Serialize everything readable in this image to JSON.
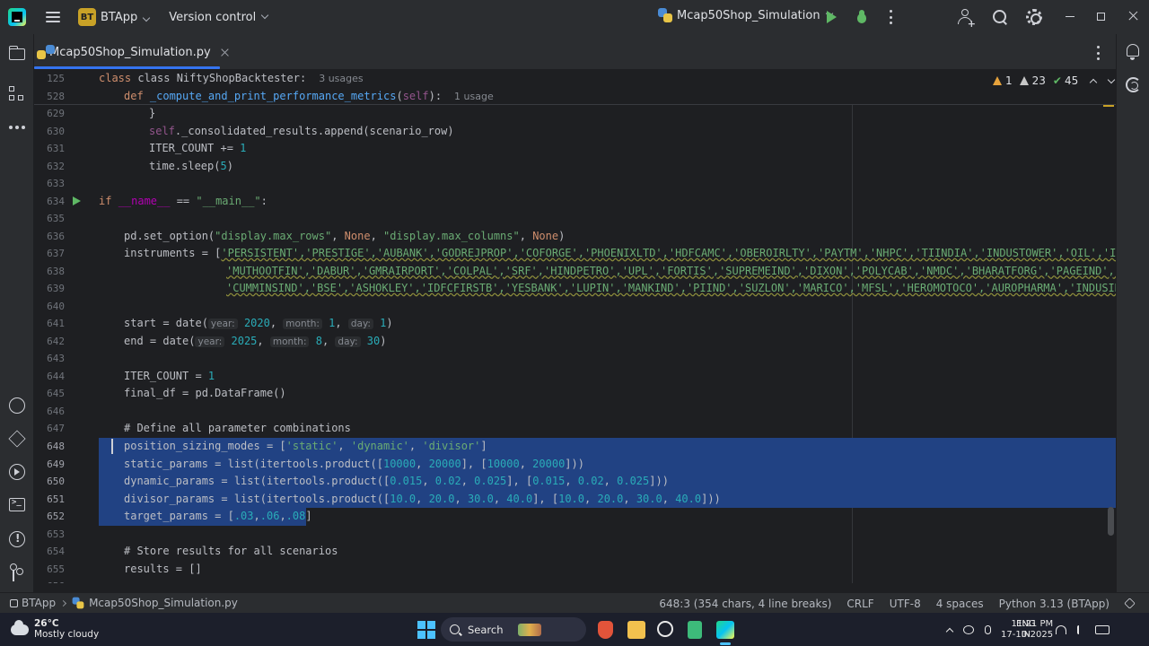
{
  "titlebar": {
    "project_badge": "BT",
    "project_name": "BTApp",
    "vcs_label": "Version control",
    "run_config": "Mcap50Shop_Simulation",
    "icons": [
      "app-logo-icon",
      "hamburger-menu-icon",
      "chevron-down-icon",
      "run-icon",
      "debug-icon",
      "more-icon",
      "add-user-icon",
      "search-icon",
      "gear-icon",
      "minimize-icon",
      "maximize-icon",
      "close-icon"
    ]
  },
  "tab": {
    "label": "Mcap50Shop_Simulation.py"
  },
  "inspections": {
    "warnings": "1",
    "weak_warnings": "23",
    "ok": "45"
  },
  "sticky": [
    {
      "ln": "125",
      "code": "class NiftyShopBacktester:",
      "usage": "3 usages"
    },
    {
      "ln": "528",
      "code": "def _compute_and_print_performance_metrics(self):",
      "usage": "1 usage"
    }
  ],
  "code": {
    "l629": {
      "ln": "629",
      "t": "}"
    },
    "l630": {
      "ln": "630",
      "a": "self",
      "b": "._consolidated_results.append(scenario_row)"
    },
    "l631": {
      "ln": "631",
      "a": "ITER_COUNT += ",
      "b": "1"
    },
    "l632": {
      "ln": "632",
      "a": "time.sleep(",
      "b": "5",
      "c": ")"
    },
    "l633": {
      "ln": "633"
    },
    "l634": {
      "ln": "634",
      "kw": "if ",
      "a": "__name__",
      "b": " == ",
      "s": "\"__main__\"",
      "c": ":"
    },
    "l635": {
      "ln": "635"
    },
    "l636": {
      "ln": "636",
      "a": "pd.set_option(",
      "s1": "\"display.max_rows\"",
      "b": ", ",
      "k1": "None",
      "c": ", ",
      "s2": "\"display.max_columns\"",
      "d": ", ",
      "k2": "None",
      "e": ")"
    },
    "l637": {
      "ln": "637",
      "a": "instruments = [",
      "s": "'PERSISTENT','PRESTIGE','AUBANK','GODREJPROP','COFORGE','PHOENIXLTD','HDFCAMC','OBEROIRLTY','PAYTM','NHPC','TIINDIA','INDUSTOWER','OIL','IRCTC'"
    },
    "l638": {
      "ln": "638",
      "s": "'MUTHOOTFIN','DABUR','GMRAIRPORT','COLPAL','SRF','HINDPETRO','UPL','FORTIS','SUPREMEIND','DIXON','POLYCAB','NMDC','BHARATFORG','PAGEIND','JUBL"
    },
    "l639": {
      "ln": "639",
      "s": "'CUMMINSIND','BSE','ASHOKLEY','IDFCFIRSTB','YESBANK','LUPIN','MANKIND','PIIND','SUZLON','MARICO','MFSL','HEROMOTOCO','AUROPHARMA','INDUSINDBK'"
    },
    "l640": {
      "ln": "640"
    },
    "l641": {
      "ln": "641",
      "a": "start = date(",
      "h1": "year:",
      "n1": "2020",
      "b": ", ",
      "h2": "month:",
      "n2": "1",
      "c": ", ",
      "h3": "day:",
      "n3": "1",
      "d": ")"
    },
    "l642": {
      "ln": "642",
      "a": "end = date(",
      "h1": "year:",
      "n1": "2025",
      "b": ", ",
      "h2": "month:",
      "n2": "8",
      "c": ", ",
      "h3": "day:",
      "n3": "30",
      "d": ")"
    },
    "l643": {
      "ln": "643"
    },
    "l644": {
      "ln": "644",
      "a": "ITER_COUNT = ",
      "n": "1"
    },
    "l645": {
      "ln": "645",
      "a": "final_df = pd.DataFrame()"
    },
    "l646": {
      "ln": "646"
    },
    "l647": {
      "ln": "647",
      "cm": "# Define all parameter combinations"
    },
    "l648": {
      "ln": "648",
      "a": "position_sizing_modes = [",
      "s1": "'static'",
      "b": ", ",
      "s2": "'dynamic'",
      "c": ", ",
      "s3": "'divisor'",
      "d": "]"
    },
    "l649": {
      "ln": "649",
      "a": "static_params = list(itertools.product([",
      "n1": "10000",
      "b": ", ",
      "n2": "20000",
      "c": "], [",
      "n3": "10000",
      "d": ", ",
      "n4": "20000",
      "e": "]))"
    },
    "l650": {
      "ln": "650",
      "a": "dynamic_params = list(itertools.product([",
      "n1": "0.015",
      "b": ", ",
      "n2": "0.02",
      "c": ", ",
      "n3": "0.025",
      "d": "], [",
      "n4": "0.015",
      "e": ", ",
      "n5": "0.02",
      "f": ", ",
      "n6": "0.025",
      "g": "]))"
    },
    "l651": {
      "ln": "651",
      "a": "divisor_params = list(itertools.product([",
      "n1": "10.0",
      "b": ", ",
      "n2": "20.0",
      "c": ", ",
      "n3": "30.0",
      "d": ", ",
      "n4": "40.0",
      "e": "], [",
      "n5": "10.0",
      "f": ", ",
      "n6": "20.0",
      "g": ", ",
      "n7": "30.0",
      "h": ", ",
      "n8": "40.0",
      "i": "]))"
    },
    "l652": {
      "ln": "652",
      "a": "target_params = [",
      "n1": ".03",
      "b": ",",
      "n2": ".06",
      "c": ",",
      "n3": ".08",
      "d": "]"
    },
    "l653": {
      "ln": "653"
    },
    "l654": {
      "ln": "654",
      "cm": "# Store results for all scenarios"
    },
    "l655": {
      "ln": "655",
      "a": "results = []"
    },
    "l656": {
      "ln": "656"
    }
  },
  "statusbar": {
    "project": "BTApp",
    "file": "Mcap50Shop_Simulation.py",
    "position": "648:3 (354 chars, 4 line breaks)",
    "line_sep": "CRLF",
    "encoding": "UTF-8",
    "indent": "4 spaces",
    "interpreter": "Python 3.13 (BTApp)"
  },
  "taskbar": {
    "temp": "26°C",
    "weather": "Mostly cloudy",
    "search": "Search",
    "lang1": "ENG",
    "lang2": "IN",
    "time": "11:21 PM",
    "date": "17-10-2025"
  }
}
